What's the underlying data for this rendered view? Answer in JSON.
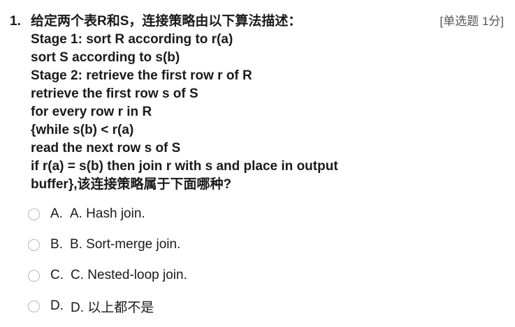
{
  "question": {
    "number": "1.",
    "type_label": "[单选题 1分]",
    "stem_lines": [
      "给定两个表R和S，连接策略由以下算法描述：",
      "Stage 1: sort R according to r(a)",
      "sort S according to s(b)",
      "Stage 2: retrieve the first row r of R",
      "retrieve the first row s of S",
      "for every row r in R",
      "{while s(b) < r(a)",
      "read the next row s of S",
      "if r(a) = s(b) then join r with s and place in output",
      "buffer},该连接策略属于下面哪种?"
    ]
  },
  "options": [
    {
      "letter": "A.",
      "text": "A. Hash join."
    },
    {
      "letter": "B.",
      "text": "B. Sort-merge join."
    },
    {
      "letter": "C.",
      "text": "C. Nested-loop join."
    },
    {
      "letter": "D.",
      "text": "D. 以上都不是"
    }
  ]
}
